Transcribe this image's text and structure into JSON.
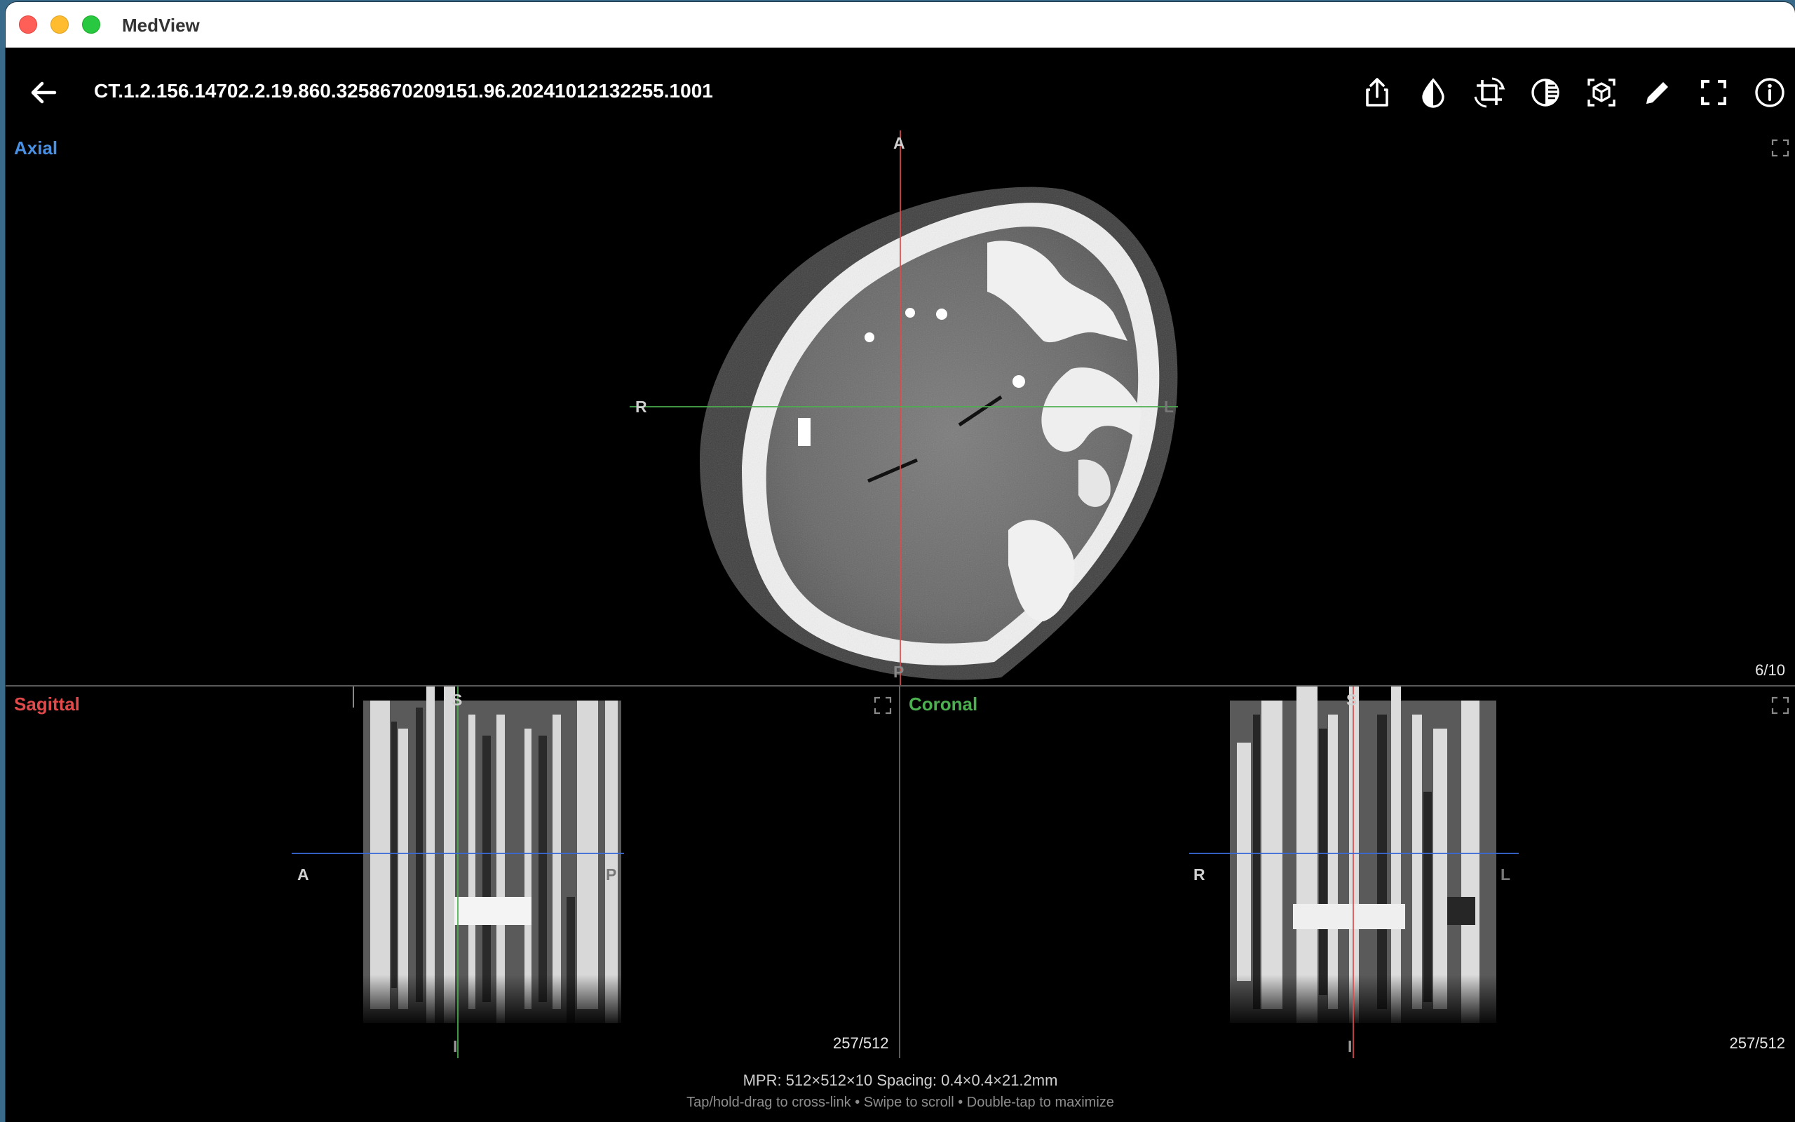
{
  "window": {
    "app_title": "MedView"
  },
  "toolbar": {
    "series_title": "CT.1.2.156.14702.2.19.860.3258670209151.96.20241012132255.1001",
    "tools": [
      {
        "name": "share-icon"
      },
      {
        "name": "window-level-icon"
      },
      {
        "name": "crop-icon"
      },
      {
        "name": "invert-icon"
      },
      {
        "name": "3d-render-icon"
      },
      {
        "name": "annotate-pencil-icon"
      },
      {
        "name": "fullscreen-icon"
      },
      {
        "name": "info-icon"
      }
    ]
  },
  "panes": {
    "axial": {
      "label": "Axial",
      "color": "#4a90e2",
      "orient_top": "A",
      "orient_left": "R",
      "orient_right": "L",
      "orient_bottom": "P",
      "counter": "6/10"
    },
    "sagittal": {
      "label": "Sagittal",
      "color": "#e04a4a",
      "orient_top": "S",
      "orient_left": "A",
      "orient_right": "P",
      "orient_bottom": "I",
      "counter": "257/512"
    },
    "coronal": {
      "label": "Coronal",
      "color": "#4caf50",
      "orient_top": "S",
      "orient_left": "R",
      "orient_right": "L",
      "orient_bottom": "I",
      "counter": "257/512"
    }
  },
  "crosshair_colors": {
    "red": "#e04a4a",
    "green": "#4caf50",
    "blue": "#3a6ad8"
  },
  "footer": {
    "info": "MPR: 512×512×10  Spacing: 0.4×0.4×21.2mm",
    "hint": "Tap/hold-drag to cross-link  •  Swipe to scroll  •  Double-tap to maximize"
  }
}
